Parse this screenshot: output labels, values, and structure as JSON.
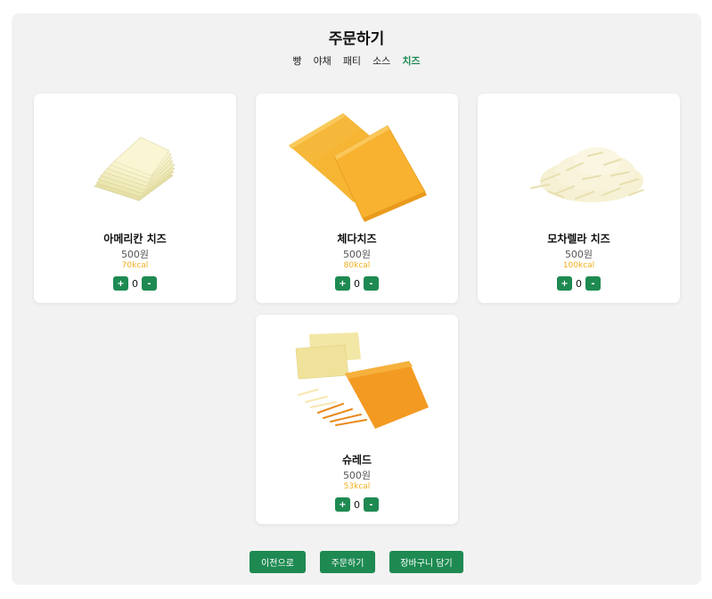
{
  "header": {
    "title": "주문하기"
  },
  "tabs": [
    {
      "label": "빵",
      "active": false
    },
    {
      "label": "야채",
      "active": false
    },
    {
      "label": "패티",
      "active": false
    },
    {
      "label": "소스",
      "active": false
    },
    {
      "label": "치즈",
      "active": true
    }
  ],
  "products": [
    {
      "name": "아메리칸 치즈",
      "price": "500원",
      "kcal": "70kcal",
      "qty": "0",
      "image": "american-cheese-slices-image"
    },
    {
      "name": "체다치즈",
      "price": "500원",
      "kcal": "80kcal",
      "qty": "0",
      "image": "cheddar-cheese-slices-image"
    },
    {
      "name": "모차렐라 치즈",
      "price": "500원",
      "kcal": "100kcal",
      "qty": "0",
      "image": "shredded-mozzarella-image"
    },
    {
      "name": "슈레드",
      "price": "500원",
      "kcal": "53kcal",
      "qty": "0",
      "image": "shredded-cheese-mix-image"
    }
  ],
  "controls": {
    "plus": "+",
    "minus": "-"
  },
  "footer": {
    "prev_label": "이전으로",
    "order_label": "주문하기",
    "cart_label": "장바구니 담기"
  },
  "colors": {
    "accent": "#1e8a52",
    "kcal": "#f2b01e",
    "panel": "#f2f2f2"
  }
}
